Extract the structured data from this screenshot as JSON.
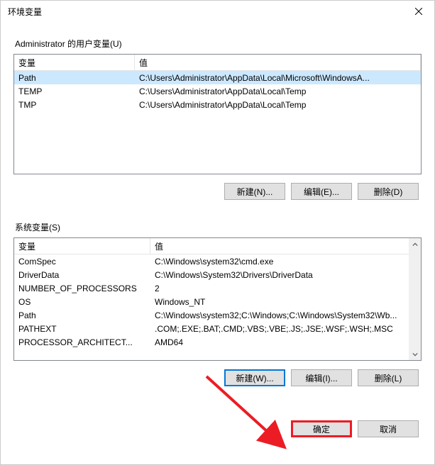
{
  "window": {
    "title": "环境变量"
  },
  "user_section": {
    "label": "Administrator 的用户变量(U)",
    "columns": {
      "var": "变量",
      "val": "值"
    },
    "rows": [
      {
        "var": "Path",
        "val": "C:\\Users\\Administrator\\AppData\\Local\\Microsoft\\WindowsA..."
      },
      {
        "var": "TEMP",
        "val": "C:\\Users\\Administrator\\AppData\\Local\\Temp"
      },
      {
        "var": "TMP",
        "val": "C:\\Users\\Administrator\\AppData\\Local\\Temp"
      }
    ],
    "buttons": {
      "new": "新建(N)...",
      "edit": "编辑(E)...",
      "delete": "删除(D)"
    }
  },
  "system_section": {
    "label": "系统变量(S)",
    "columns": {
      "var": "变量",
      "val": "值"
    },
    "rows": [
      {
        "var": "ComSpec",
        "val": "C:\\Windows\\system32\\cmd.exe"
      },
      {
        "var": "DriverData",
        "val": "C:\\Windows\\System32\\Drivers\\DriverData"
      },
      {
        "var": "NUMBER_OF_PROCESSORS",
        "val": "2"
      },
      {
        "var": "OS",
        "val": "Windows_NT"
      },
      {
        "var": "Path",
        "val": "C:\\Windows\\system32;C:\\Windows;C:\\Windows\\System32\\Wb..."
      },
      {
        "var": "PATHEXT",
        "val": ".COM;.EXE;.BAT;.CMD;.VBS;.VBE;.JS;.JSE;.WSF;.WSH;.MSC"
      },
      {
        "var": "PROCESSOR_ARCHITECT...",
        "val": "AMD64"
      }
    ],
    "buttons": {
      "new": "新建(W)...",
      "edit": "编辑(I)...",
      "delete": "删除(L)"
    }
  },
  "footer": {
    "ok": "确定",
    "cancel": "取消"
  }
}
